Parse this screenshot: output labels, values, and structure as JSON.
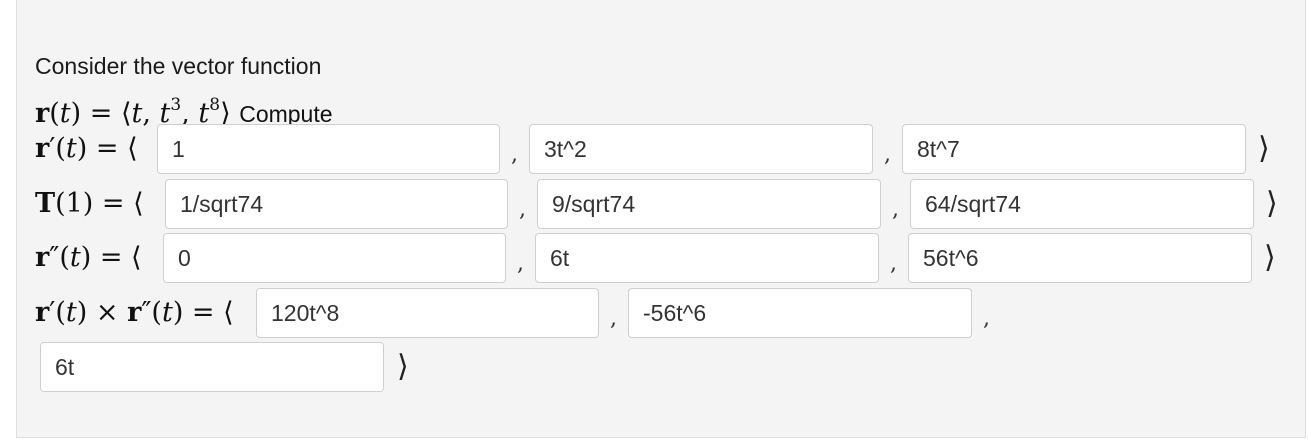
{
  "intro_text": "Consider the vector function",
  "compute_text": "Compute",
  "answers": {
    "r_prime": [
      "1",
      "3t^2",
      "8t^7"
    ],
    "T_at_1": [
      "1/sqrt74",
      "9/sqrt74",
      "64/sqrt74"
    ],
    "r_double_prime": [
      "0",
      "6t",
      "56t^6"
    ],
    "cross_product": [
      "120t^8",
      "-56t^6",
      "6t"
    ]
  }
}
